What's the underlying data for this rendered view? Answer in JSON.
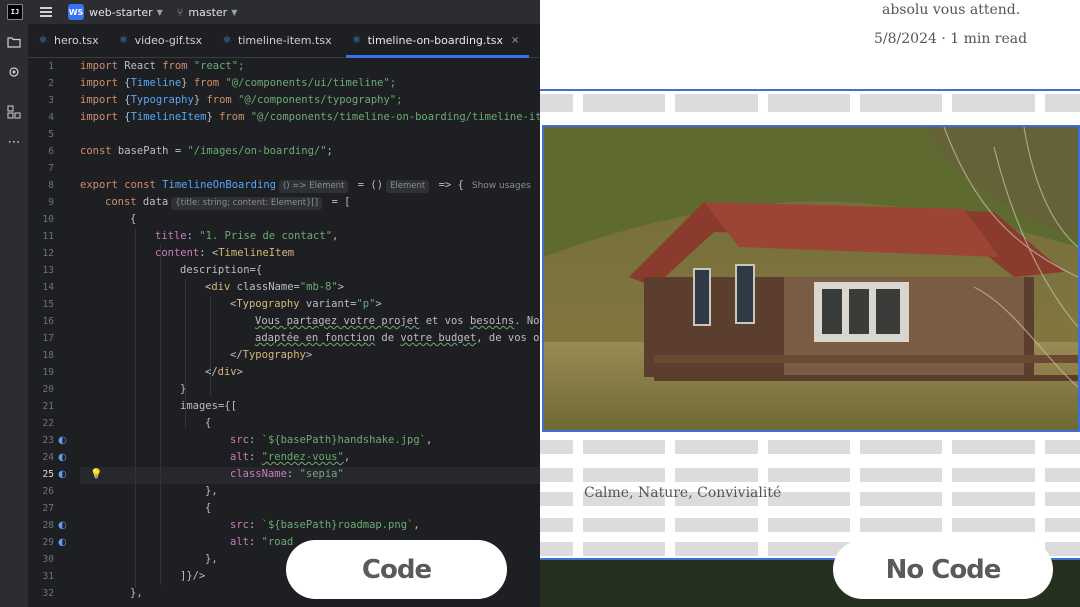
{
  "ide": {
    "app_logo": "IJ",
    "project_badge": "WS",
    "project_name": "web-starter",
    "branch": "master",
    "tabs": [
      {
        "label": "hero.tsx",
        "active": false
      },
      {
        "label": "video-gif.tsx",
        "active": false
      },
      {
        "label": "timeline-item.tsx",
        "active": false
      },
      {
        "label": "timeline-on-boarding.tsx",
        "active": true
      }
    ],
    "tab_close": "×",
    "current_line": 25,
    "hints": {
      "fn_type": "() => Element",
      "return_type": "Element",
      "show_usages": "Show usages",
      "data_type": "{title: string; content: Element}[]"
    },
    "line_numbers": [
      "1",
      "2",
      "3",
      "4",
      "5",
      "6",
      "7",
      "8",
      "9",
      "10",
      "11",
      "12",
      "13",
      "14",
      "15",
      "16",
      "17",
      "18",
      "19",
      "20",
      "21",
      "22",
      "23",
      "24",
      "25",
      "26",
      "27",
      "28",
      "29",
      "30",
      "31",
      "32"
    ],
    "code": {
      "l1": [
        "import",
        " React ",
        "from",
        " \"react\";"
      ],
      "l2": [
        "import",
        " {",
        "Timeline",
        "} ",
        "from",
        " \"@/components/ui/timeline\";"
      ],
      "l3": [
        "import",
        " {",
        "Typography",
        "} ",
        "from",
        " \"@/components/typography\";"
      ],
      "l4": [
        "import",
        " {",
        "TimelineItem",
        "} ",
        "from",
        " \"@/components/timeline-on-boarding/timeline-it"
      ],
      "l6": [
        "const",
        " basePath = ",
        "\"/images/on-boarding/\"",
        ";"
      ],
      "l8": [
        "export const",
        " TimelineOnBoarding",
        " = ()",
        " => {"
      ],
      "l9": [
        "const",
        " data",
        " = ["
      ],
      "l10": "{",
      "l11": [
        "title",
        ": ",
        "\"1. Prise de contact\"",
        ","
      ],
      "l12": [
        "content",
        ": <",
        "TimelineItem"
      ],
      "l13": [
        "description",
        "={"
      ],
      "l14": [
        "<",
        "div",
        " className",
        "=",
        "\"mb-8\"",
        ">"
      ],
      "l15": [
        "<",
        "Typography",
        " variant",
        "=",
        "\"p\"",
        ">"
      ],
      "l16": [
        "Vous partagez votre projet",
        " et vos ",
        "besoins",
        ". Nou"
      ],
      "l17": [
        "adaptée en fonction",
        " de ",
        "votre budget",
        ", de vos o"
      ],
      "l18": [
        "</",
        "Typography",
        ">"
      ],
      "l19": [
        "</",
        "div",
        ">"
      ],
      "l20": "}",
      "l21": [
        "images",
        "={["
      ],
      "l22": "{",
      "l23": [
        "src",
        ": ",
        "`${basePath}",
        "handshake.jpg`",
        ","
      ],
      "l24": [
        "alt",
        ": ",
        "\"rendez-vous\"",
        ","
      ],
      "l25": [
        "className",
        ": ",
        "\"sepia\""
      ],
      "l26": "},",
      "l27": "{",
      "l28": [
        "src",
        ": ",
        "`${basePath}",
        "roadmap.png`",
        ","
      ],
      "l29": [
        "alt",
        ": ",
        "\"road"
      ],
      "l30": "},",
      "l31": "]}/>",
      "l32": "},"
    }
  },
  "buttons": {
    "code": "Code",
    "no_code": "No Code"
  },
  "blog": {
    "line1": "absolu vous attend.",
    "meta": "5/8/2024 · 1 min read",
    "caption": "Calme, Nature, Convivialité"
  },
  "icons": [
    "app-logo-icon",
    "hamburger-menu-icon",
    "branch-icon",
    "chevron-down-icon",
    "folder-icon",
    "commit-icon",
    "structure-icon",
    "more-icon",
    "react-file-icon",
    "close-icon",
    "override-marker-icon",
    "lightbulb-icon"
  ],
  "colors": {
    "accent": "#3574f0",
    "selection": "#3c6fd8"
  }
}
